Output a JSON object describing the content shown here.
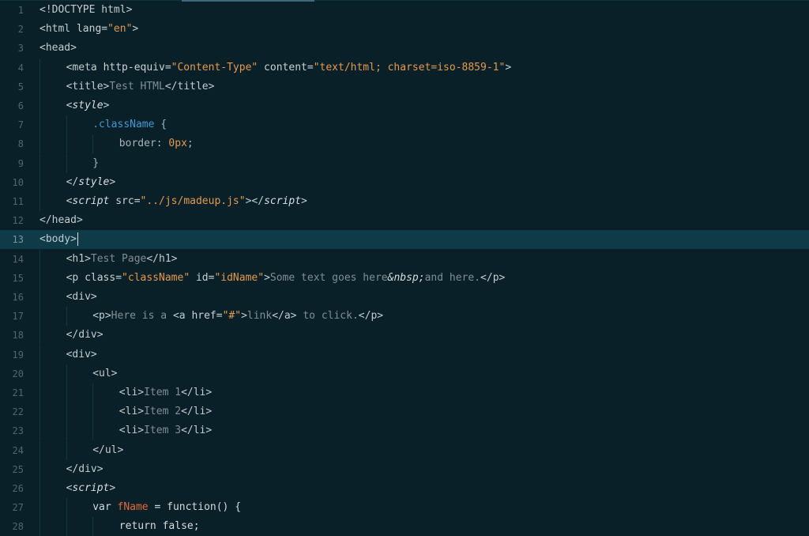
{
  "active_line": 13,
  "lines": [
    {
      "n": "1",
      "indent": 0,
      "tokens": [
        {
          "t": "<!DOCTYPE html>",
          "c": "tag"
        }
      ]
    },
    {
      "n": "2",
      "indent": 0,
      "tokens": [
        {
          "t": "<html ",
          "c": "tag"
        },
        {
          "t": "lang=",
          "c": "attr"
        },
        {
          "t": "\"en\"",
          "c": "str"
        },
        {
          "t": ">",
          "c": "tag"
        }
      ]
    },
    {
      "n": "3",
      "indent": 0,
      "tokens": [
        {
          "t": "<head>",
          "c": "tag"
        }
      ]
    },
    {
      "n": "4",
      "indent": 1,
      "tokens": [
        {
          "t": "<meta ",
          "c": "tag"
        },
        {
          "t": "http-equiv=",
          "c": "attr"
        },
        {
          "t": "\"Content-Type\"",
          "c": "str"
        },
        {
          "t": " content=",
          "c": "attr"
        },
        {
          "t": "\"text/html; charset=iso-8859-1\"",
          "c": "str"
        },
        {
          "t": ">",
          "c": "tag"
        }
      ]
    },
    {
      "n": "5",
      "indent": 1,
      "tokens": [
        {
          "t": "<title>",
          "c": "tag"
        },
        {
          "t": "Test HTML",
          "c": "text"
        },
        {
          "t": "</title>",
          "c": "tag"
        }
      ]
    },
    {
      "n": "6",
      "indent": 1,
      "tokens": [
        {
          "t": "<",
          "c": "tag"
        },
        {
          "t": "style",
          "c": "tag-it"
        },
        {
          "t": ">",
          "c": "tag"
        }
      ]
    },
    {
      "n": "7",
      "indent": 2,
      "tokens": [
        {
          "t": ".className",
          "c": "sel"
        },
        {
          "t": " {",
          "c": "plain"
        }
      ]
    },
    {
      "n": "8",
      "indent": 3,
      "tokens": [
        {
          "t": "border: ",
          "c": "plain"
        },
        {
          "t": "0px",
          "c": "num"
        },
        {
          "t": ";",
          "c": "plain"
        }
      ]
    },
    {
      "n": "9",
      "indent": 2,
      "tokens": [
        {
          "t": "}",
          "c": "plain"
        }
      ]
    },
    {
      "n": "10",
      "indent": 1,
      "tokens": [
        {
          "t": "</",
          "c": "tag"
        },
        {
          "t": "style",
          "c": "tag-it"
        },
        {
          "t": ">",
          "c": "tag"
        }
      ]
    },
    {
      "n": "11",
      "indent": 1,
      "tokens": [
        {
          "t": "<",
          "c": "tag"
        },
        {
          "t": "script",
          "c": "tag-it"
        },
        {
          "t": " src=",
          "c": "attr"
        },
        {
          "t": "\"../js/madeup.js\"",
          "c": "str"
        },
        {
          "t": "></",
          "c": "tag"
        },
        {
          "t": "script",
          "c": "tag-it"
        },
        {
          "t": ">",
          "c": "tag"
        }
      ]
    },
    {
      "n": "12",
      "indent": 0,
      "tokens": [
        {
          "t": "</head>",
          "c": "tag"
        }
      ]
    },
    {
      "n": "13",
      "indent": 0,
      "tokens": [
        {
          "t": "<body>",
          "c": "tag"
        }
      ]
    },
    {
      "n": "14",
      "indent": 1,
      "tokens": [
        {
          "t": "<h1>",
          "c": "tag"
        },
        {
          "t": "Test Page",
          "c": "text"
        },
        {
          "t": "</h1>",
          "c": "tag"
        }
      ]
    },
    {
      "n": "15",
      "indent": 1,
      "tokens": [
        {
          "t": "<p ",
          "c": "tag"
        },
        {
          "t": "class=",
          "c": "attr"
        },
        {
          "t": "\"className\"",
          "c": "str"
        },
        {
          "t": " id=",
          "c": "attr"
        },
        {
          "t": "\"idName\"",
          "c": "str"
        },
        {
          "t": ">",
          "c": "tag"
        },
        {
          "t": "Some text goes here",
          "c": "text"
        },
        {
          "t": "&nbsp;",
          "c": "ent"
        },
        {
          "t": "and here.",
          "c": "text"
        },
        {
          "t": "</p>",
          "c": "tag"
        }
      ]
    },
    {
      "n": "16",
      "indent": 1,
      "tokens": [
        {
          "t": "<div>",
          "c": "tag"
        }
      ]
    },
    {
      "n": "17",
      "indent": 2,
      "tokens": [
        {
          "t": "<p>",
          "c": "tag"
        },
        {
          "t": "Here is a ",
          "c": "text"
        },
        {
          "t": "<a ",
          "c": "tag"
        },
        {
          "t": "href=",
          "c": "attr"
        },
        {
          "t": "\"#\"",
          "c": "str"
        },
        {
          "t": ">",
          "c": "tag"
        },
        {
          "t": "link",
          "c": "text"
        },
        {
          "t": "</a>",
          "c": "tag"
        },
        {
          "t": " to click.",
          "c": "text"
        },
        {
          "t": "</p>",
          "c": "tag"
        }
      ]
    },
    {
      "n": "18",
      "indent": 1,
      "tokens": [
        {
          "t": "</div>",
          "c": "tag"
        }
      ]
    },
    {
      "n": "19",
      "indent": 1,
      "tokens": [
        {
          "t": "<div>",
          "c": "tag"
        }
      ]
    },
    {
      "n": "20",
      "indent": 2,
      "tokens": [
        {
          "t": "<ul>",
          "c": "tag"
        }
      ]
    },
    {
      "n": "21",
      "indent": 3,
      "tokens": [
        {
          "t": "<li>",
          "c": "tag"
        },
        {
          "t": "Item 1",
          "c": "text"
        },
        {
          "t": "</li>",
          "c": "tag"
        }
      ]
    },
    {
      "n": "22",
      "indent": 3,
      "tokens": [
        {
          "t": "<li>",
          "c": "tag"
        },
        {
          "t": "Item 2",
          "c": "text"
        },
        {
          "t": "</li>",
          "c": "tag"
        }
      ]
    },
    {
      "n": "23",
      "indent": 3,
      "tokens": [
        {
          "t": "<li>",
          "c": "tag"
        },
        {
          "t": "Item 3",
          "c": "text"
        },
        {
          "t": "</li>",
          "c": "tag"
        }
      ]
    },
    {
      "n": "24",
      "indent": 2,
      "tokens": [
        {
          "t": "</ul>",
          "c": "tag"
        }
      ]
    },
    {
      "n": "25",
      "indent": 1,
      "tokens": [
        {
          "t": "</div>",
          "c": "tag"
        }
      ]
    },
    {
      "n": "26",
      "indent": 1,
      "tokens": [
        {
          "t": "<",
          "c": "tag"
        },
        {
          "t": "script",
          "c": "tag-it"
        },
        {
          "t": ">",
          "c": "tag"
        }
      ]
    },
    {
      "n": "27",
      "indent": 2,
      "tokens": [
        {
          "t": "var ",
          "c": "kw"
        },
        {
          "t": "fName",
          "c": "fn"
        },
        {
          "t": " = function() {",
          "c": "kw"
        }
      ]
    },
    {
      "n": "28",
      "indent": 3,
      "tokens": [
        {
          "t": "return false;",
          "c": "kw"
        }
      ]
    }
  ]
}
